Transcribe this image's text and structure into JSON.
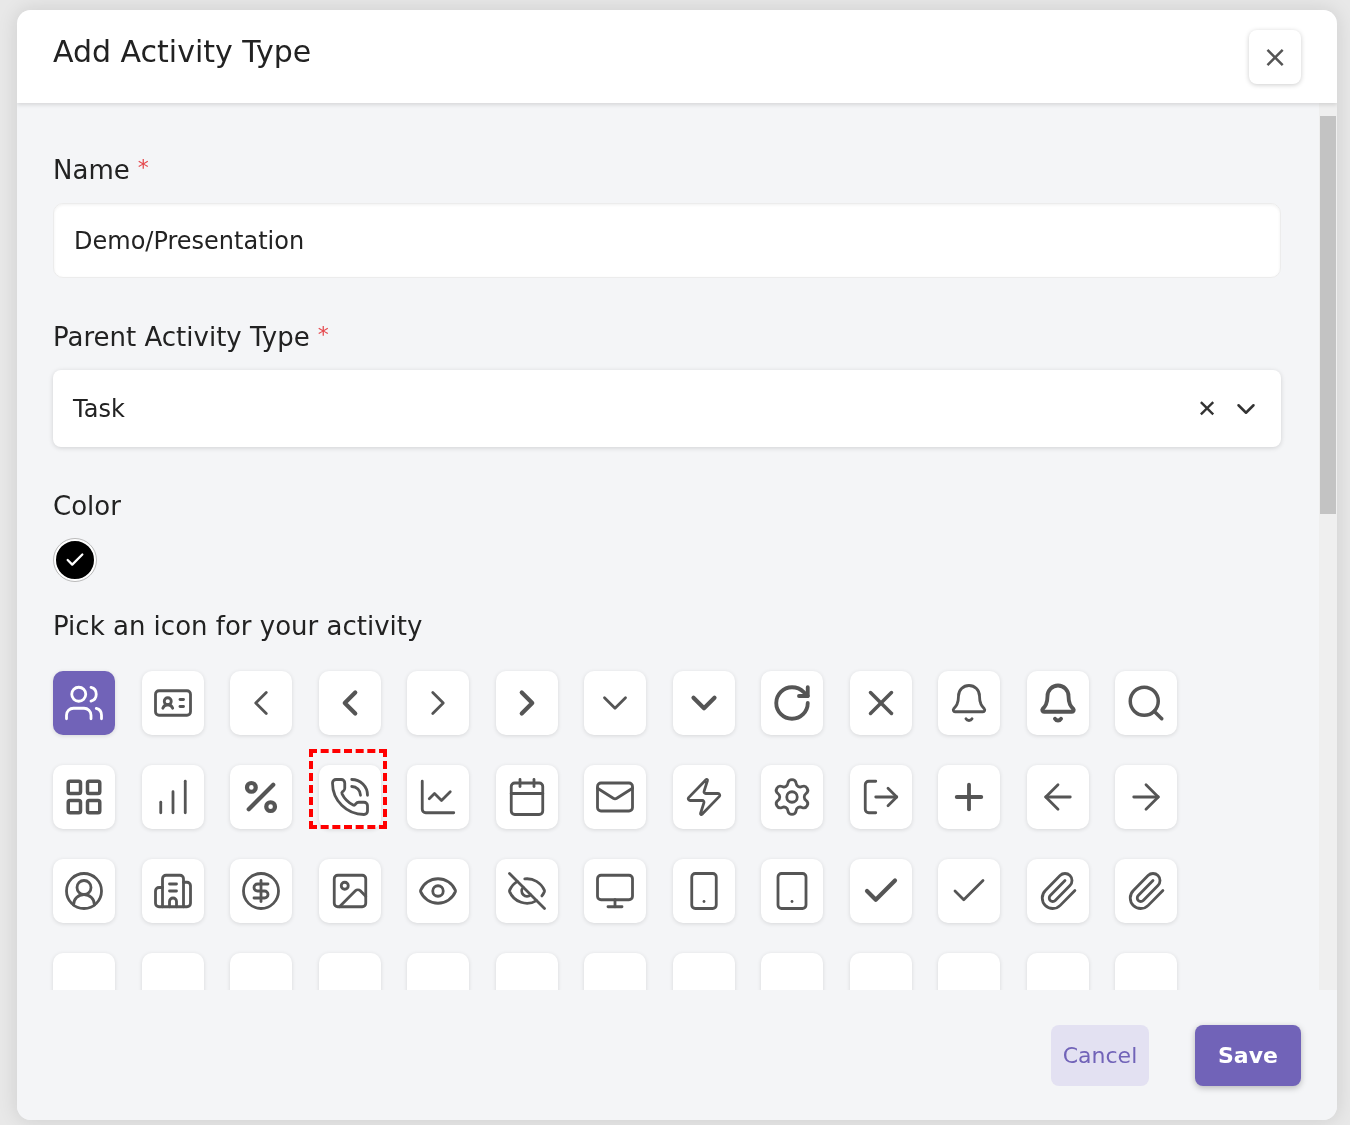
{
  "dialog": {
    "title": "Add Activity Type",
    "close_label": "×"
  },
  "name_field": {
    "label": "Name",
    "required_mark": "*",
    "value": "Demo/Presentation"
  },
  "parent_field": {
    "label": "Parent Activity Type",
    "required_mark": "*",
    "value": "Task",
    "clear_label": "✕"
  },
  "color_field": {
    "label": "Color",
    "colors": [
      {
        "color": "#000000",
        "selected": true
      }
    ]
  },
  "icon_picker": {
    "label": "Pick an icon for your activity",
    "icons": [
      {
        "selected": true,
        "highlighted": false
      },
      {
        "selected": false,
        "highlighted": false
      },
      {
        "selected": false,
        "highlighted": false
      },
      {
        "selected": false,
        "highlighted": false
      },
      {
        "selected": false,
        "highlighted": false
      },
      {
        "selected": false,
        "highlighted": false
      },
      {
        "selected": false,
        "highlighted": false
      },
      {
        "selected": false,
        "highlighted": false
      },
      {
        "selected": false,
        "highlighted": false
      },
      {
        "selected": false,
        "highlighted": false
      },
      {
        "selected": false,
        "highlighted": false
      },
      {
        "selected": false,
        "highlighted": false
      },
      {
        "selected": false,
        "highlighted": false
      },
      {
        "selected": false,
        "highlighted": false
      },
      {
        "selected": false,
        "highlighted": false
      },
      {
        "selected": false,
        "highlighted": false
      },
      {
        "selected": false,
        "highlighted": true
      },
      {
        "selected": false,
        "highlighted": false
      },
      {
        "selected": false,
        "highlighted": false
      },
      {
        "selected": false,
        "highlighted": false
      },
      {
        "selected": false,
        "highlighted": false
      },
      {
        "selected": false,
        "highlighted": false
      },
      {
        "selected": false,
        "highlighted": false
      },
      {
        "selected": false,
        "highlighted": false
      },
      {
        "selected": false,
        "highlighted": false
      },
      {
        "selected": false,
        "highlighted": false
      },
      {
        "selected": false,
        "highlighted": false
      },
      {
        "selected": false,
        "highlighted": false
      },
      {
        "selected": false,
        "highlighted": false
      },
      {
        "selected": false,
        "highlighted": false
      },
      {
        "selected": false,
        "highlighted": false
      },
      {
        "selected": false,
        "highlighted": false
      },
      {
        "selected": false,
        "highlighted": false
      },
      {
        "selected": false,
        "highlighted": false
      },
      {
        "selected": false,
        "highlighted": false
      },
      {
        "selected": false,
        "highlighted": false
      },
      {
        "selected": false,
        "highlighted": false
      },
      {
        "selected": false,
        "highlighted": false
      },
      {
        "selected": false,
        "highlighted": false
      },
      {
        "selected": false,
        "highlighted": false
      },
      {
        "selected": false,
        "highlighted": false
      },
      {
        "selected": false,
        "highlighted": false
      },
      {
        "selected": false,
        "highlighted": false
      },
      {
        "selected": false,
        "highlighted": false
      },
      {
        "selected": false,
        "highlighted": false
      },
      {
        "selected": false,
        "highlighted": false
      },
      {
        "selected": false,
        "highlighted": false
      },
      {
        "selected": false,
        "highlighted": false
      },
      {
        "selected": false,
        "highlighted": false
      },
      {
        "selected": false,
        "highlighted": false
      },
      {
        "selected": false,
        "highlighted": false
      },
      {
        "selected": false,
        "highlighted": false
      }
    ]
  },
  "buttons": [
    {
      "label": "Cancel",
      "kind": "secondary"
    },
    {
      "label": "Save",
      "kind": "primary"
    }
  ]
}
